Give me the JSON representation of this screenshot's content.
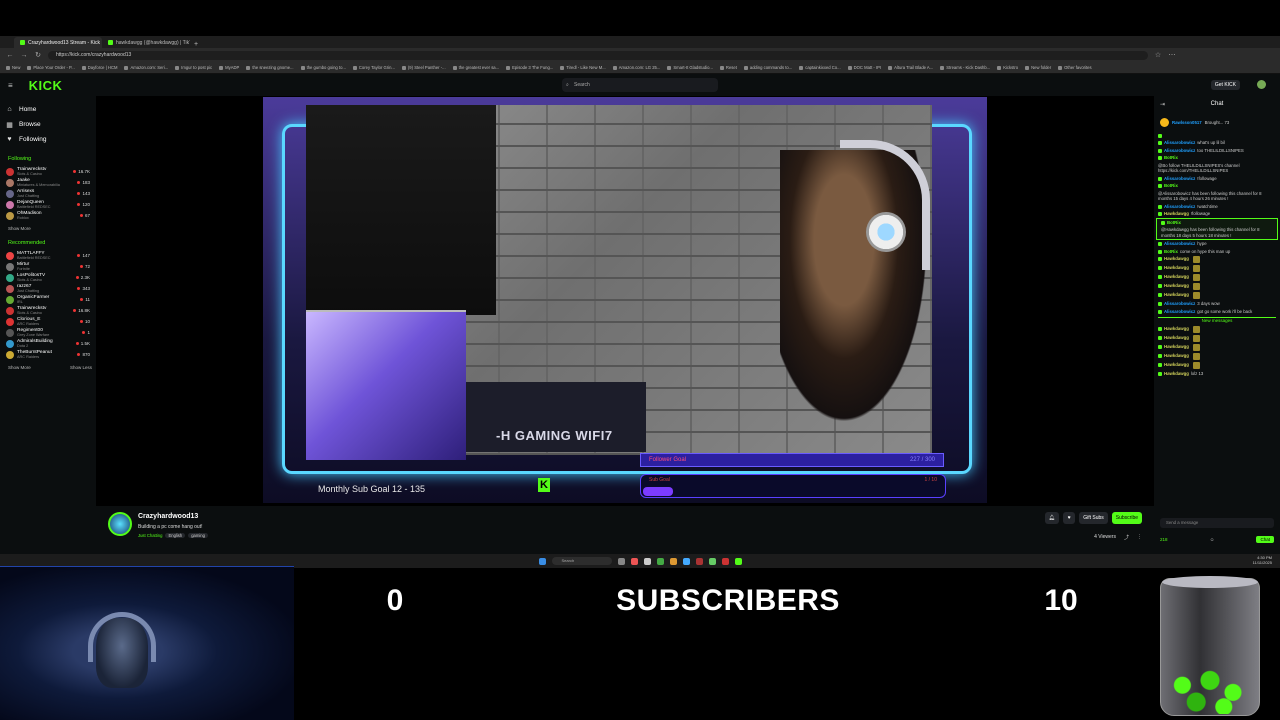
{
  "browser": {
    "tabs": [
      {
        "label": "Crazyhardwood13 Stream - Kick",
        "active": true
      },
      {
        "label": "hawkdawgg (@hawkdawgg) | TikTok",
        "active": false
      }
    ],
    "url": "https://kick.com/crazyhardwood13",
    "bookmarks": [
      "New",
      "Place Your Order - P...",
      "Dayforce | HCM",
      "Amazon.com: Seri...",
      "Imgur to post pic",
      "MyADP",
      "the sneezing gnome...",
      "the gumbo going to...",
      "Corey Taylor Grin...",
      "(9) Steel Panther -...",
      "the greatest ever sa...",
      "Episode 3 The Fung...",
      "Tiredl - Like New M...",
      "Amazon.com: LG 25...",
      "Smart-It Gladstudio...",
      "Reset",
      "adding commands to...",
      "captainkixxed Co...",
      "DOC Matt - IPI",
      "Altura Trail Blade A...",
      "Streams - Kick Dashb...",
      "Kickstro",
      "New folder",
      "Other favorites"
    ]
  },
  "kick": {
    "logo": "KICK",
    "search_placeholder": "Search",
    "get_kick": "Get KICK",
    "nav": [
      {
        "label": "Home",
        "icon": "home-icon",
        "glyph": "⌂"
      },
      {
        "label": "Browse",
        "icon": "browse-icon",
        "glyph": "▦"
      },
      {
        "label": "Following",
        "icon": "heart-icon",
        "glyph": "♥"
      }
    ],
    "following_head": "Following",
    "following": [
      {
        "name": "Trainwreckstv",
        "cat": "Slots & Casino",
        "viewers": "16.7K",
        "color": "#c33"
      },
      {
        "name": "Jaake",
        "cat": "Miniatures & Memorabilia",
        "viewers": "183",
        "color": "#a76"
      },
      {
        "name": "Arrisexs",
        "cat": "Just Chatting",
        "viewers": "143",
        "color": "#668"
      },
      {
        "name": "DejanQueen",
        "cat": "Battlefield REDSEC",
        "viewers": "120",
        "color": "#c7a"
      },
      {
        "name": "OhMadison",
        "cat": "Roblox",
        "viewers": "67",
        "color": "#b94"
      }
    ],
    "show_more": "Show More",
    "recommended_head": "Recommended",
    "recommended": [
      {
        "name": "MATTLAFFY",
        "cat": "Battlefield REDSEC",
        "viewers": "147",
        "color": "#e44"
      },
      {
        "name": "Mirtur",
        "cat": "Fortnite",
        "viewers": "72",
        "color": "#777"
      },
      {
        "name": "LosPolitosTV",
        "cat": "Slots & Casino",
        "viewers": "2.3K",
        "color": "#3a8"
      },
      {
        "name": "razz67",
        "cat": "Just Chatting",
        "viewers": "343",
        "color": "#b55"
      },
      {
        "name": "OrganicFarmer",
        "cat": "IRL",
        "viewers": "11",
        "color": "#6a3"
      },
      {
        "name": "Trainwreckstv",
        "cat": "Slots & Casino",
        "viewers": "16.8K",
        "color": "#c33"
      },
      {
        "name": "Clorious_E",
        "cat": "ARC Raiders",
        "viewers": "10",
        "color": "#d33"
      },
      {
        "name": "Regiment00",
        "cat": "Grey Zone Warfare",
        "viewers": "1",
        "color": "#555"
      },
      {
        "name": "AdmiralsBuilding",
        "cat": "Dota 2",
        "viewers": "1.5K",
        "color": "#39c"
      },
      {
        "name": "TheBurntPeanut",
        "cat": "ARC Raiders",
        "viewers": "870",
        "color": "#ca3"
      }
    ],
    "show_more2": "Show More",
    "show_less": "Show Less"
  },
  "stream": {
    "gaming_text": "-H GAMING WIFI7",
    "sub_goal": "Monthly Sub Goal  12 - 135",
    "follower_goal": "Follower Goal",
    "follower_count": "227 / 300",
    "sub_goal_bar_label": "Sub Goal",
    "sub_goal_bar_count": "1 / 10",
    "sub_goal_progress": 0.1
  },
  "channel": {
    "name": "Crazyhardwood13",
    "title": "Building a pc come hang out!",
    "category": "Just Chatting",
    "tags": [
      "English",
      "gaming"
    ],
    "gift_subs": "Gift Subs",
    "subscribe": "Subscribe",
    "viewers": "4 Viewers"
  },
  "chat": {
    "title": "Chat",
    "pinned_user": "Rawlsson0517",
    "pinned_text": "Brought... 73",
    "messages": [
      {
        "user": "",
        "text": "",
        "color": "#ff3b3b"
      },
      {
        "user": "Alissarobowicz",
        "text": "what's up lil bil",
        "color": "#1fa0ff"
      },
      {
        "user": "Alissarobowicz",
        "text": "too THELILDILLSNIPES",
        "color": "#1fa0ff"
      },
      {
        "user": "BotRix",
        "text": "@Bo follow THELILDILLSNIPES's channel https://kick.com/THELILDILLSNIPES",
        "color": "#53fc18"
      },
      {
        "user": "Alissarobowicz",
        "text": "!followage",
        "color": "#1fa0ff"
      },
      {
        "user": "BotRix",
        "text": "@Alissarobowicz has been following this channel for 8 months 15 days 4 hours 26 minutes !",
        "color": "#53fc18"
      },
      {
        "user": "Alissarobowicz",
        "text": "!watchtime",
        "color": "#1fa0ff"
      },
      {
        "user": "Hawkdawgg",
        "text": "!followage",
        "color": "#cfcf5a"
      },
      {
        "user": "BotRix",
        "text": "@Hawkdawgg has been following this channel for 8 months 18 days 5 hours 18 minutes !",
        "color": "#53fc18",
        "hl": true
      },
      {
        "user": "Alissarobowicz",
        "text": "hype",
        "color": "#1fa0ff"
      },
      {
        "user": "BotRix",
        "text": "come on hype this man up",
        "color": "#53fc18"
      },
      {
        "user": "Hawkdawgg",
        "text": "",
        "color": "#cfcf5a",
        "emote": true
      },
      {
        "user": "Hawkdawgg",
        "text": "",
        "color": "#cfcf5a",
        "emote": true
      },
      {
        "user": "Hawkdawgg",
        "text": "",
        "color": "#cfcf5a",
        "emote": true
      },
      {
        "user": "Hawkdawgg",
        "text": "",
        "color": "#cfcf5a",
        "emote": true
      },
      {
        "user": "Hawkdawgg",
        "text": "",
        "color": "#cfcf5a",
        "emote": true
      },
      {
        "user": "Alissarobowicz",
        "text": "3 days wow",
        "color": "#1fa0ff"
      },
      {
        "user": "Alissarobowicz",
        "text": "got go some work i'll be back",
        "color": "#1fa0ff"
      }
    ],
    "new_messages": "New messages",
    "new": [
      {
        "user": "Hawkdawgg",
        "text": "",
        "color": "#cfcf5a",
        "emote": true
      },
      {
        "user": "Hawkdawgg",
        "text": "",
        "color": "#cfcf5a",
        "emote": true
      },
      {
        "user": "Hawkdawgg",
        "text": "",
        "color": "#cfcf5a",
        "emote": true
      },
      {
        "user": "Hawkdawgg",
        "text": "",
        "color": "#cfcf5a",
        "emote": true
      },
      {
        "user": "Hawkdawgg",
        "text": "",
        "color": "#cfcf5a",
        "emote": true
      },
      {
        "user": "Hawkdawgg",
        "text": "lolz 13",
        "color": "#cfcf5a"
      }
    ],
    "input_placeholder": "Send a message",
    "points": "218",
    "chat_button": "Chat"
  },
  "taskbar": {
    "search": "Search",
    "time": "4:30 PM",
    "date": "11/11/2025"
  },
  "overlay": {
    "left_count": "0",
    "label": "SUBSCRIBERS",
    "right_count": "10"
  }
}
